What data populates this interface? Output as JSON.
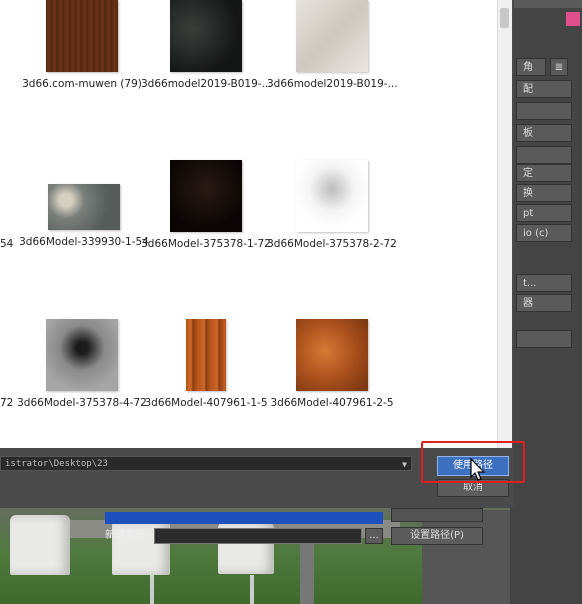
{
  "files": [
    {
      "name": "3d66.com-muwen (79)",
      "icon": "wood-texture-thumbnail"
    },
    {
      "name": "3d66model2019-B019-...",
      "icon": "black-marble-thumbnail"
    },
    {
      "name": "3d66model2019-B019-...",
      "icon": "white-marble-thumbnail"
    },
    {
      "name": "54",
      "icon": "cropped-thumbnail"
    },
    {
      "name": "3d66Model-339930-1-54",
      "icon": "world-map-thumbnail"
    },
    {
      "name": "3d66Model-375378-1-72",
      "icon": "dark-ornament-thumbnail"
    },
    {
      "name": "3d66Model-375378-2-72",
      "icon": "sketch-ornament-thumbnail"
    },
    {
      "name": "72",
      "icon": "cropped-thumbnail"
    },
    {
      "name": "3d66Model-375378-4-72",
      "icon": "gray-ornament-thumbnail"
    },
    {
      "name": "3d66Model-407961-1-5",
      "icon": "wood-plank-thumbnail"
    },
    {
      "name": "3d66Model-407961-2-5",
      "icon": "orange-wood-thumbnail"
    }
  ],
  "path_bar": {
    "value": "istrator\\Desktop\\23",
    "dropdown_icon": "chevron-down-icon"
  },
  "buttons": {
    "use_path": "使用路径",
    "cancel": "取消",
    "browse": "...",
    "set_path": "设置路径(P)"
  },
  "lower_panel": {
    "new_path_label": "新建路径:",
    "new_path_value": ""
  },
  "right_panel": {
    "items": [
      "角",
      "配",
      "板",
      "定",
      "换",
      "pt",
      "io (c)",
      "t...",
      "器"
    ]
  },
  "colors": {
    "accent": "#3e70c0",
    "highlight": "#e02020",
    "pink_swatch": "#e0508a"
  }
}
